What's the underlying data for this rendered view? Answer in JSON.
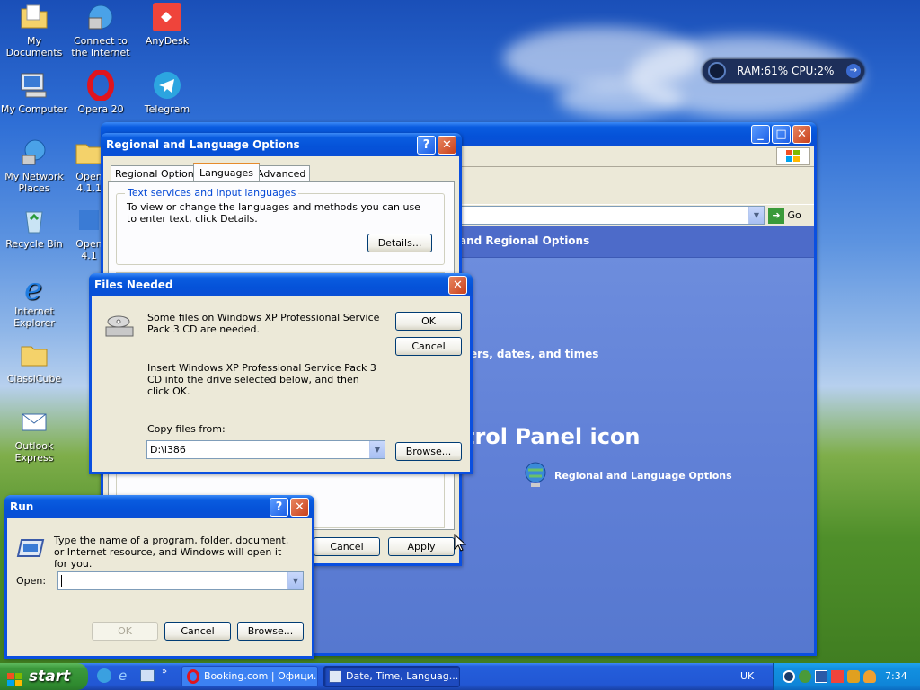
{
  "desktop": {
    "icons": [
      {
        "label": "My Documents"
      },
      {
        "label": "Connect to the Internet"
      },
      {
        "label": "AnyDesk"
      },
      {
        "label": "My Computer"
      },
      {
        "label": "Opera 20"
      },
      {
        "label": "Telegram"
      },
      {
        "label": "My Network Places"
      },
      {
        "label": "Open 4.1.1"
      },
      {
        "label": "Recycle Bin"
      },
      {
        "label": "Open 4.1"
      },
      {
        "label": "Internet Explorer"
      },
      {
        "label": "ClassiCube"
      },
      {
        "label": "Outlook Express"
      }
    ]
  },
  "monitor": {
    "text": "RAM:61% CPU:2%"
  },
  "control_panel": {
    "go_label": "Go",
    "header_text": "and Regional Options",
    "task_text": "ers, dates, and times",
    "pick_heading": "trol Panel icon",
    "icon_link": "Regional and Language Options"
  },
  "regional": {
    "title": "Regional and Language Options",
    "tabs": [
      "Regional Options",
      "Languages",
      "Advanced"
    ],
    "group_label": "Text services and input languages",
    "desc": "To view or change the languages and methods you can use to enter text, click Details.",
    "details_btn": "Details...",
    "cancel_btn": "Cancel",
    "apply_btn": "Apply"
  },
  "files_needed": {
    "title": "Files Needed",
    "msg1": "Some files on Windows XP Professional Service Pack 3 CD are needed.",
    "msg2": "Insert Windows XP Professional Service Pack 3 CD into the drive selected below, and then click OK.",
    "copy_label": "Copy files from:",
    "path_value": "D:\\i386",
    "ok_btn": "OK",
    "cancel_btn": "Cancel",
    "browse_btn": "Browse..."
  },
  "run": {
    "title": "Run",
    "desc": "Type the name of a program, folder, document, or Internet resource, and Windows will open it for you.",
    "open_label": "Open:",
    "open_value": "",
    "ok_btn": "OK",
    "cancel_btn": "Cancel",
    "browse_btn": "Browse..."
  },
  "taskbar": {
    "start": "start",
    "tasks": [
      "Booking.com | Офици...",
      "Date, Time, Languag..."
    ],
    "lang": "UK",
    "time": "7:34"
  }
}
